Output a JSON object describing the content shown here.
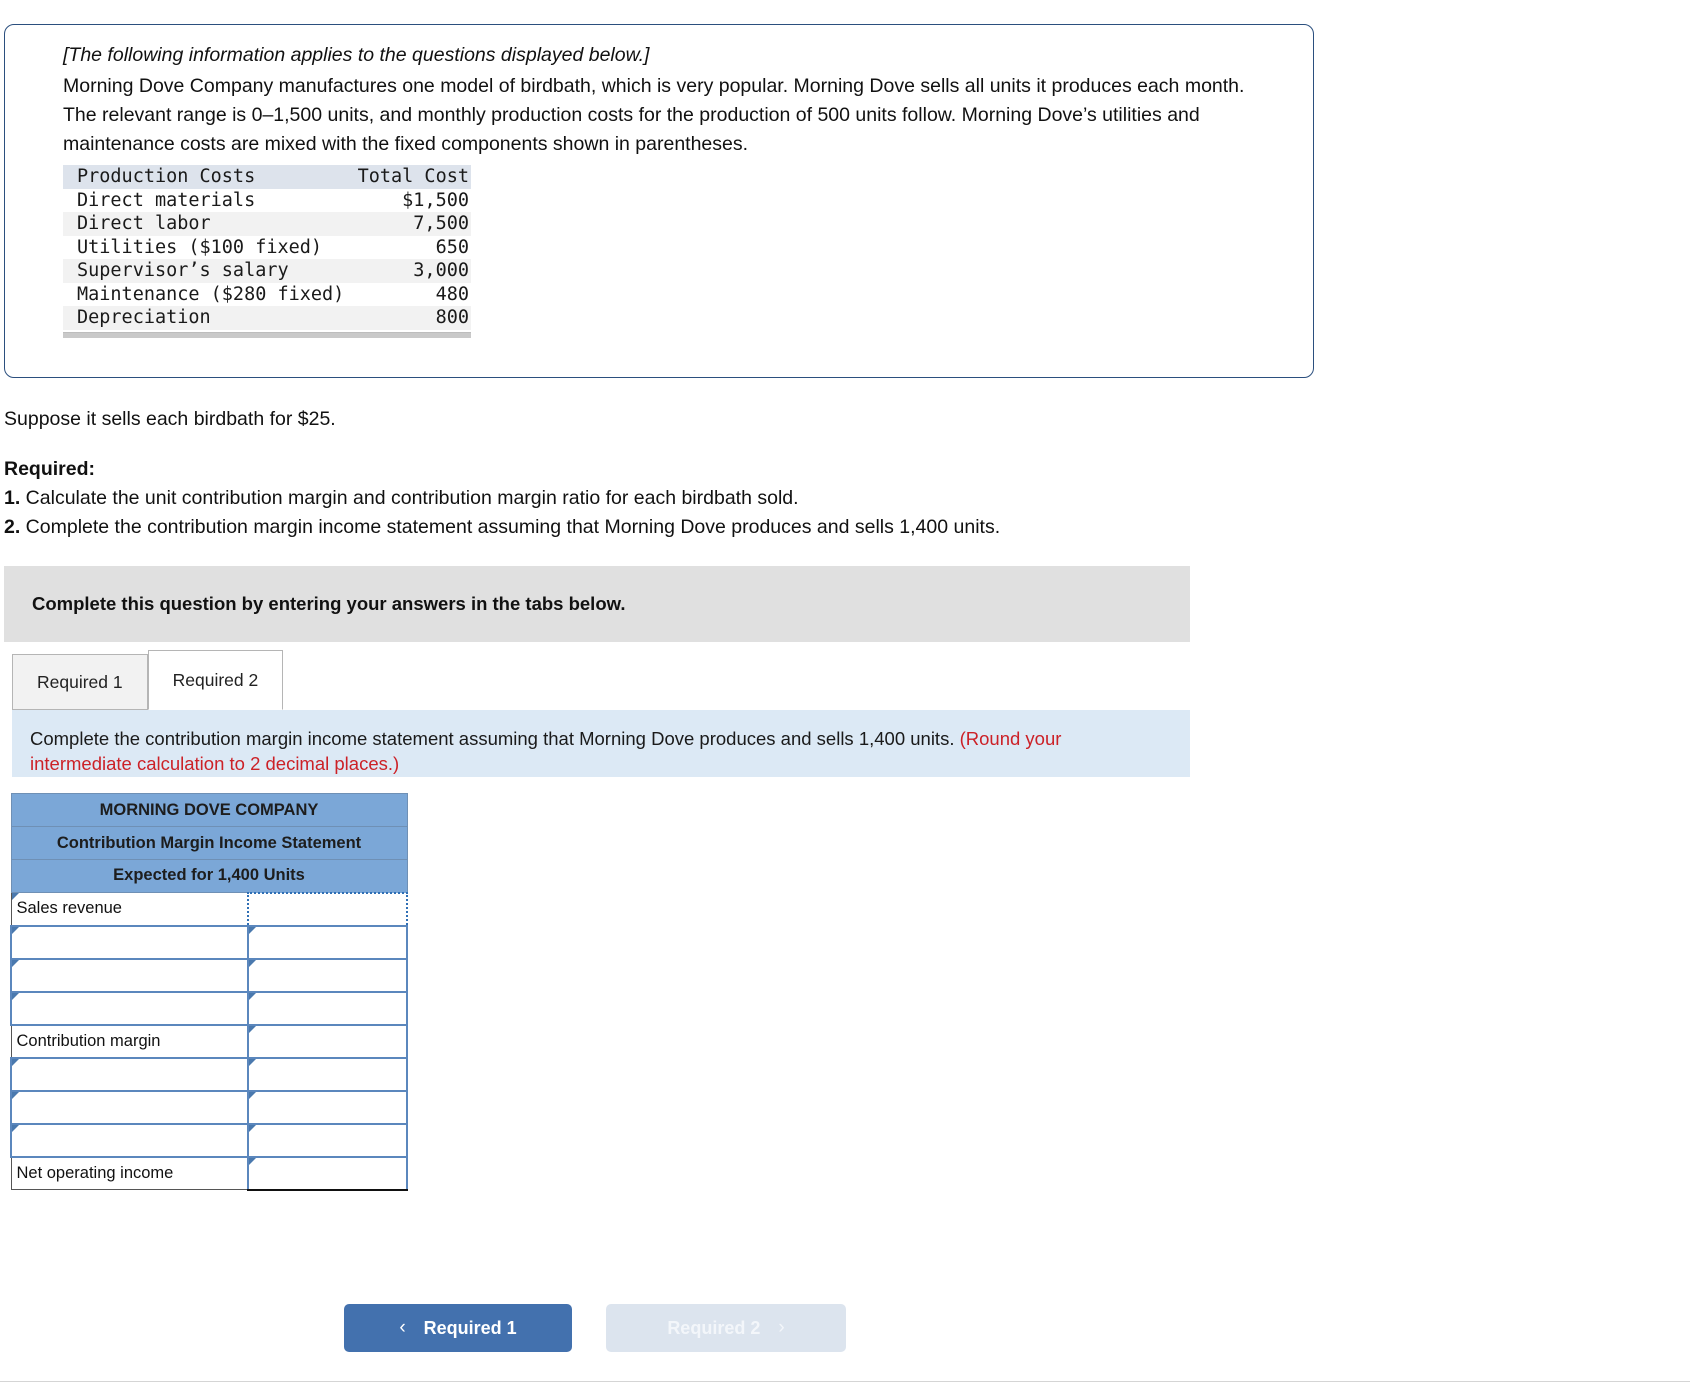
{
  "info_card": {
    "lead_italic": "[The following information applies to the questions displayed below.]",
    "body": "Morning Dove Company manufactures one model of birdbath, which is very popular. Morning Dove sells all units it produces each month. The relevant range is 0–1,500 units, and monthly production costs for the production of 500 units follow. Morning Dove’s utilities and maintenance costs are mixed with the fixed components shown in parentheses."
  },
  "production_costs": {
    "header": {
      "label": "Production Costs",
      "value": "Total Cost"
    },
    "rows": [
      {
        "label": "Direct materials",
        "value": "$1,500"
      },
      {
        "label": "Direct labor",
        "value": "7,500"
      },
      {
        "label": "Utilities ($100 fixed)",
        "value": "650"
      },
      {
        "label": "Supervisor’s salary",
        "value": "3,000"
      },
      {
        "label": "Maintenance ($280 fixed)",
        "value": "480"
      },
      {
        "label": "Depreciation",
        "value": "800"
      }
    ]
  },
  "suppose": "Suppose it sells each birdbath for $25.",
  "required": {
    "heading": "Required:",
    "item1_num": "1.",
    "item1_text": " Calculate the unit contribution margin and contribution margin ratio for each birdbath sold.",
    "item2_num": "2.",
    "item2_text": " Complete the contribution margin income statement assuming that Morning Dove produces and sells 1,400 units."
  },
  "grey_banner": "Complete this question by entering your answers in the tabs below.",
  "tabs": [
    {
      "label": "Required 1",
      "active": false
    },
    {
      "label": "Required 2",
      "active": true
    }
  ],
  "blue_banner": {
    "text": "Complete the contribution margin income statement assuming that Morning Dove produces and sells 1,400 units. ",
    "red_text_1": "(Round your",
    "red_text_2": "intermediate calculation to 2 decimal places.)"
  },
  "statement": {
    "title_line_1": "MORNING DOVE COMPANY",
    "title_line_2": "Contribution Margin Income Statement",
    "title_line_3": "Expected for 1,400 Units",
    "rows": [
      {
        "label": "Sales revenue",
        "value": "",
        "label_style": "plainbox",
        "value_style": "sel"
      },
      {
        "label": "",
        "value": "",
        "label_style": "box",
        "value_style": "box"
      },
      {
        "label": "",
        "value": "",
        "label_style": "box",
        "value_style": "box"
      },
      {
        "label": "",
        "value": "",
        "label_style": "box",
        "value_style": "box"
      },
      {
        "label": "Contribution margin",
        "value": "",
        "label_style": "plainbox",
        "value_style": "box-topline"
      },
      {
        "label": "",
        "value": "",
        "label_style": "box",
        "value_style": "box"
      },
      {
        "label": "",
        "value": "",
        "label_style": "box",
        "value_style": "box"
      },
      {
        "label": "",
        "value": "",
        "label_style": "box",
        "value_style": "box"
      },
      {
        "label": "Net operating income",
        "value": "",
        "label_style": "plainbox",
        "value_style": "box-botline"
      }
    ]
  },
  "footer": {
    "prev_label": "Required 1",
    "prev_chevron": "‹",
    "next_label": "Required 2",
    "next_chevron": "›"
  },
  "colors": {
    "header_blue": "#7ba7d7",
    "banner_blue": "#dce9f5",
    "banner_grey": "#e0e0e0",
    "accent_blue": "#4371ae",
    "red": "#cc2127",
    "cell_border": "#5b87bd"
  }
}
